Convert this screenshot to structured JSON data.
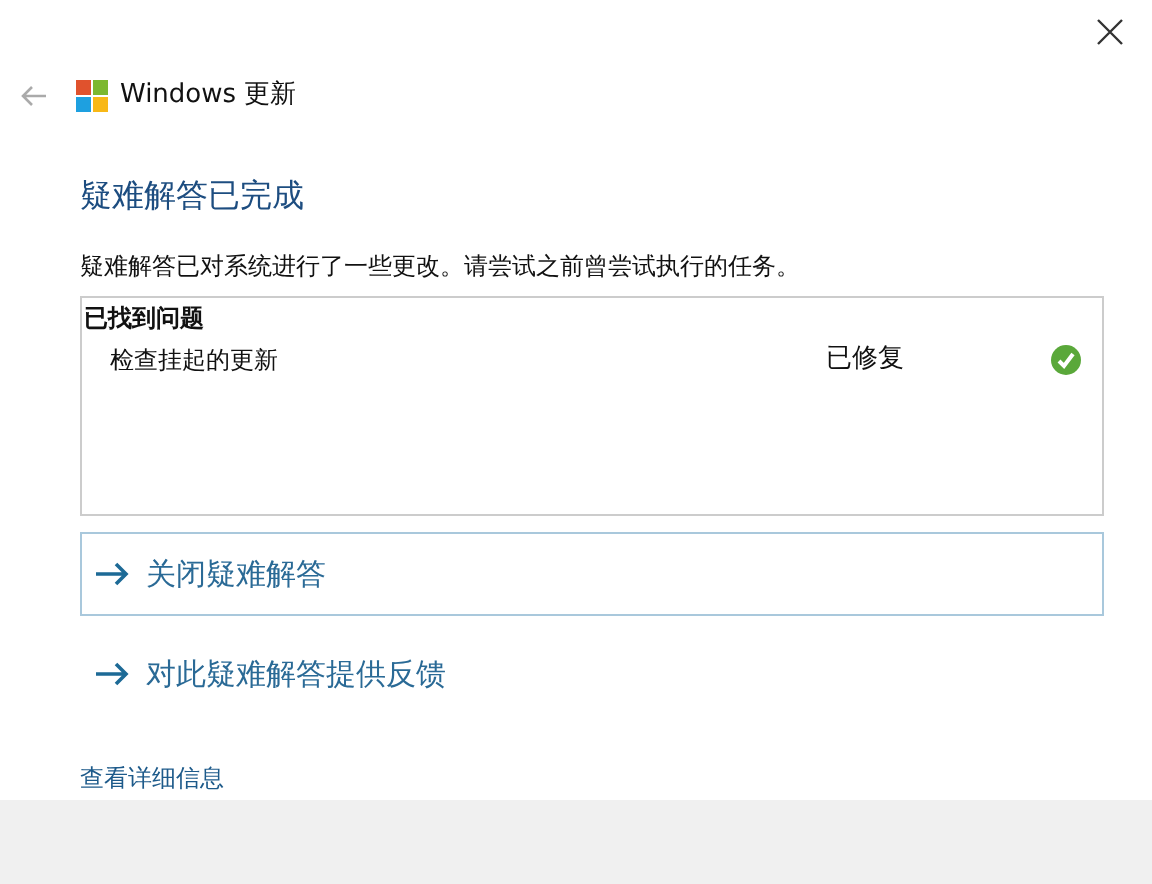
{
  "header": {
    "title": "Windows 更新"
  },
  "heading": "疑难解答已完成",
  "description": "疑难解答已对系统进行了一些更改。请尝试之前曾尝试执行的任务。",
  "results": {
    "title": "已找到问题",
    "items": [
      {
        "name": "检查挂起的更新",
        "status": "已修复",
        "kind": "fixed"
      }
    ]
  },
  "actions": [
    {
      "label": "关闭疑难解答",
      "selected": true
    },
    {
      "label": "对此疑难解答提供反馈",
      "selected": false
    }
  ],
  "details_link": "查看详细信息"
}
